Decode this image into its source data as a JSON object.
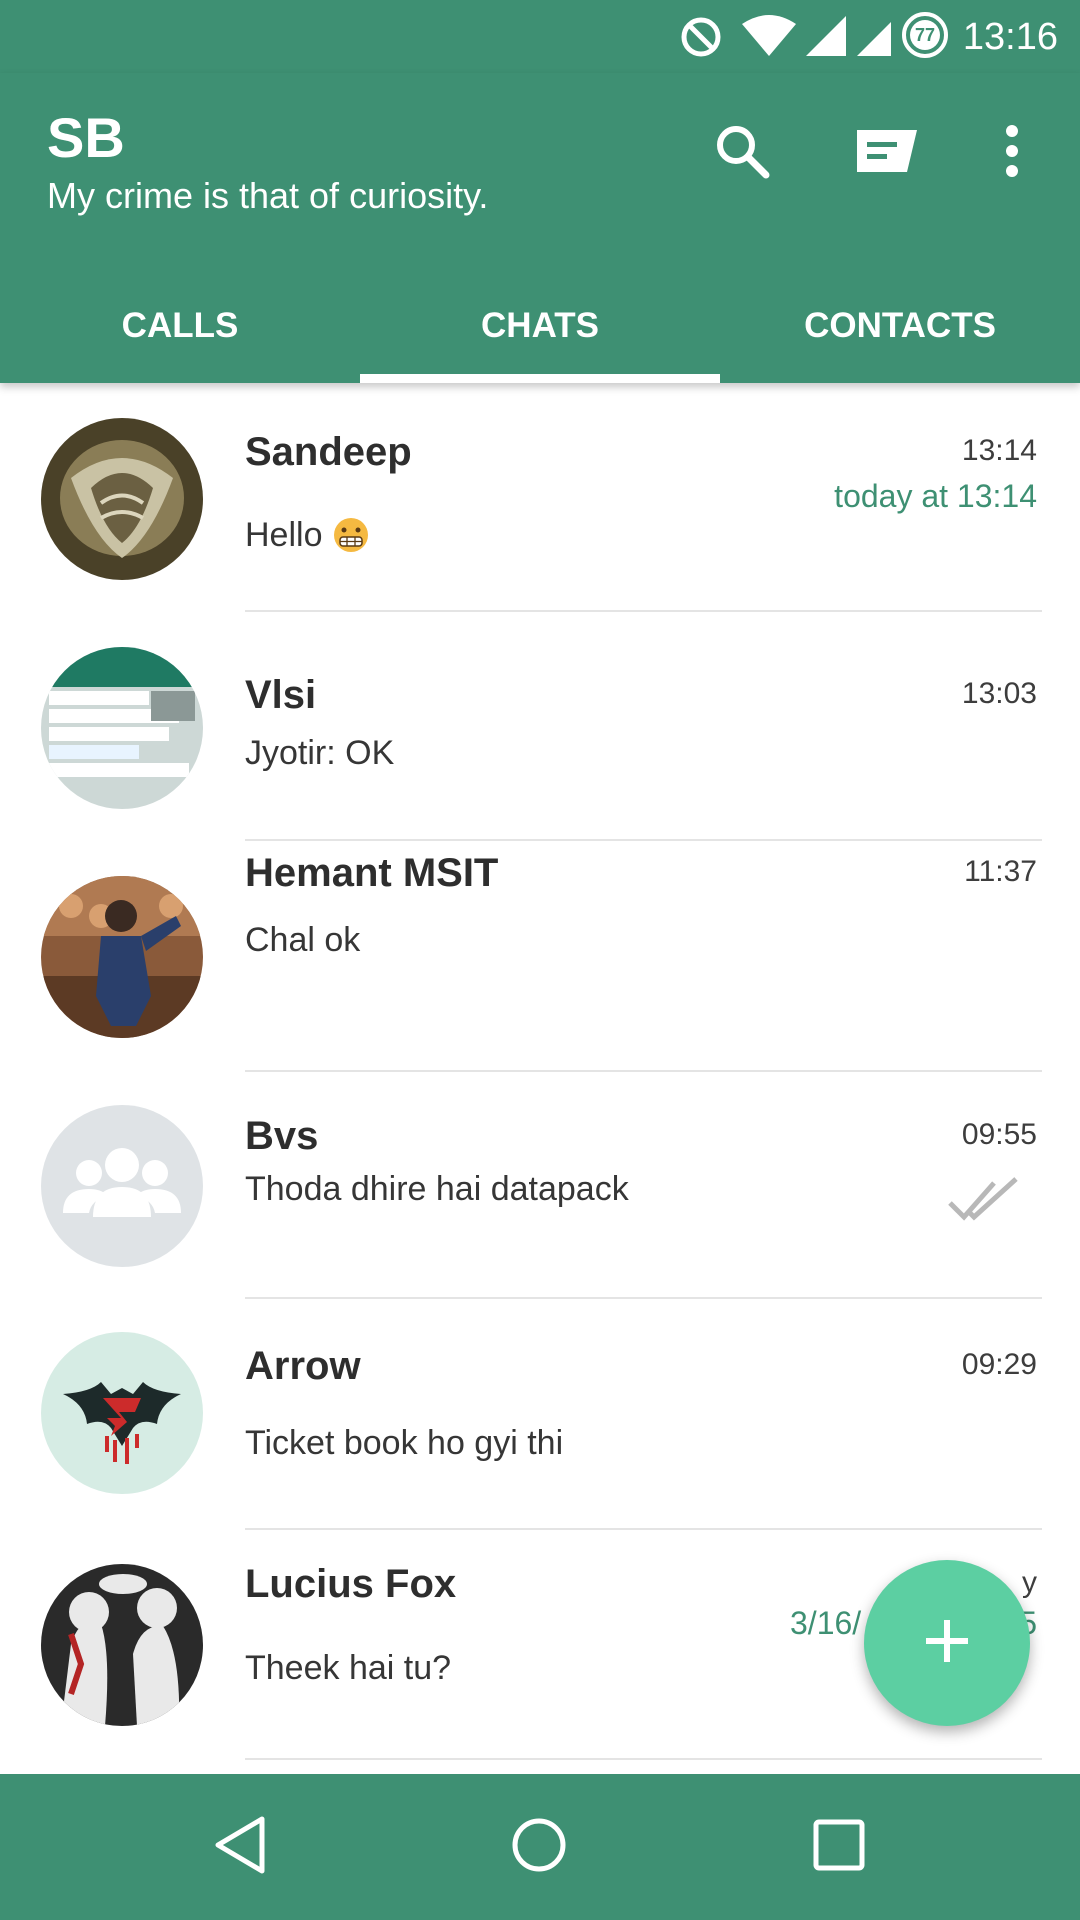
{
  "status_bar": {
    "time": "13:16",
    "battery_level": "77",
    "icons": [
      "do-not-disturb-icon",
      "wifi-icon",
      "signal-icon",
      "signal-icon",
      "battery-icon"
    ]
  },
  "header": {
    "title": "SB",
    "subtitle": "My crime is that of curiosity.",
    "actions": [
      "search-icon",
      "new-message-icon",
      "more-options-icon"
    ]
  },
  "tabs": [
    {
      "label": "CALLS",
      "active": false
    },
    {
      "label": "CHATS",
      "active": true
    },
    {
      "label": "CONTACTS",
      "active": false
    }
  ],
  "chats": [
    {
      "name": "Sandeep",
      "time": "13:14",
      "subtime": "today at 13:14",
      "message": "Hello",
      "emoji": "grimacing-emoji"
    },
    {
      "name": "Vlsi",
      "time": "13:03",
      "message": "Jyotir:  OK"
    },
    {
      "name": "Hemant MSIT",
      "time": "11:37",
      "message": "Chal ok"
    },
    {
      "name": "Bvs",
      "time": "09:55",
      "message": "Thoda dhire hai datapack",
      "status": "double-check-icon"
    },
    {
      "name": "Arrow",
      "time": "09:29",
      "message": "Ticket book ho gyi thi"
    },
    {
      "name": "Lucius Fox",
      "time": "y",
      "subtime": "3/16/",
      "subtime_tail": "5",
      "message": "Theek hai tu?"
    }
  ],
  "fab": {
    "icon": "plus-icon"
  },
  "nav": [
    "back-icon",
    "home-icon",
    "recents-icon"
  ],
  "colors": {
    "primary": "#3e9073",
    "accent": "#5ccfa2",
    "timestamp_accent": "#3e9073",
    "divider": "#e4e4e4"
  }
}
